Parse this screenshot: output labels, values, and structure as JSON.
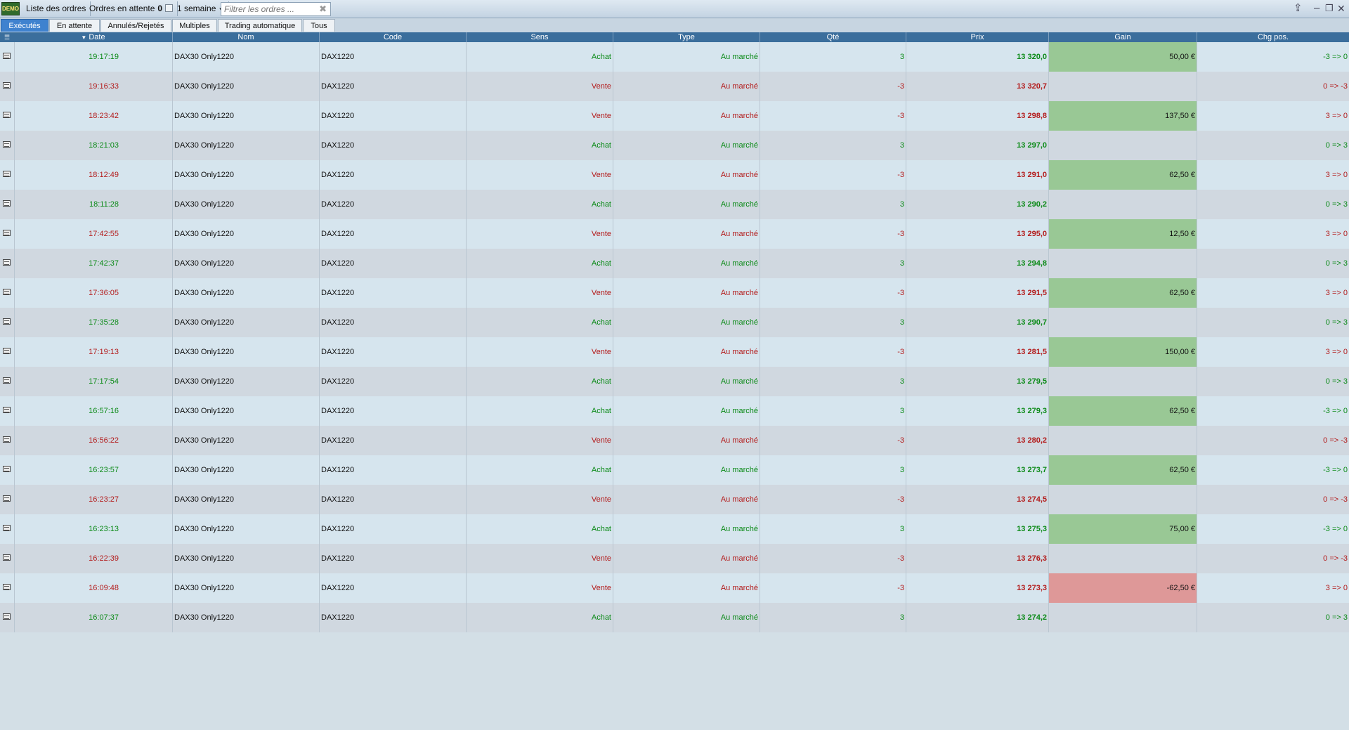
{
  "topbar": {
    "logo_label": "DEMO",
    "title": "Liste des ordres",
    "pending_label": "Ordres en attente",
    "pending_count": "0",
    "period": "1 semaine",
    "filter_placeholder": "Filtrer les ordres ...",
    "filter_clear": "✖",
    "share_icon": "⇪",
    "minimize": "–",
    "restore": "❐",
    "close": "✕"
  },
  "tabs": [
    {
      "label": "Exécutés",
      "active": true
    },
    {
      "label": "En attente"
    },
    {
      "label": "Annulés/Rejetés"
    },
    {
      "label": "Multiples"
    },
    {
      "label": "Trading automatique"
    },
    {
      "label": "Tous"
    }
  ],
  "columns": {
    "date": "Date",
    "nom": "Nom",
    "code": "Code",
    "sens": "Sens",
    "type": "Type",
    "qte": "Qté",
    "prix": "Prix",
    "gain": "Gain",
    "chg": "Chg pos."
  },
  "orders": [
    {
      "date": "19:17:19",
      "nom": "DAX30 Only1220",
      "code": "DAX1220",
      "sens": "Achat",
      "type": "Au marché",
      "qte": "3",
      "prix": "13 320,0",
      "gain": "50,00 €",
      "chg": "-3 => 0"
    },
    {
      "date": "19:16:33",
      "nom": "DAX30 Only1220",
      "code": "DAX1220",
      "sens": "Vente",
      "type": "Au marché",
      "qte": "-3",
      "prix": "13 320,7",
      "gain": "",
      "chg": "0 => -3"
    },
    {
      "date": "18:23:42",
      "nom": "DAX30 Only1220",
      "code": "DAX1220",
      "sens": "Vente",
      "type": "Au marché",
      "qte": "-3",
      "prix": "13 298,8",
      "gain": "137,50 €",
      "chg": "3 => 0"
    },
    {
      "date": "18:21:03",
      "nom": "DAX30 Only1220",
      "code": "DAX1220",
      "sens": "Achat",
      "type": "Au marché",
      "qte": "3",
      "prix": "13 297,0",
      "gain": "",
      "chg": "0 => 3"
    },
    {
      "date": "18:12:49",
      "nom": "DAX30 Only1220",
      "code": "DAX1220",
      "sens": "Vente",
      "type": "Au marché",
      "qte": "-3",
      "prix": "13 291,0",
      "gain": "62,50 €",
      "chg": "3 => 0"
    },
    {
      "date": "18:11:28",
      "nom": "DAX30 Only1220",
      "code": "DAX1220",
      "sens": "Achat",
      "type": "Au marché",
      "qte": "3",
      "prix": "13 290,2",
      "gain": "",
      "chg": "0 => 3"
    },
    {
      "date": "17:42:55",
      "nom": "DAX30 Only1220",
      "code": "DAX1220",
      "sens": "Vente",
      "type": "Au marché",
      "qte": "-3",
      "prix": "13 295,0",
      "gain": "12,50 €",
      "chg": "3 => 0"
    },
    {
      "date": "17:42:37",
      "nom": "DAX30 Only1220",
      "code": "DAX1220",
      "sens": "Achat",
      "type": "Au marché",
      "qte": "3",
      "prix": "13 294,8",
      "gain": "",
      "chg": "0 => 3"
    },
    {
      "date": "17:36:05",
      "nom": "DAX30 Only1220",
      "code": "DAX1220",
      "sens": "Vente",
      "type": "Au marché",
      "qte": "-3",
      "prix": "13 291,5",
      "gain": "62,50 €",
      "chg": "3 => 0"
    },
    {
      "date": "17:35:28",
      "nom": "DAX30 Only1220",
      "code": "DAX1220",
      "sens": "Achat",
      "type": "Au marché",
      "qte": "3",
      "prix": "13 290,7",
      "gain": "",
      "chg": "0 => 3"
    },
    {
      "date": "17:19:13",
      "nom": "DAX30 Only1220",
      "code": "DAX1220",
      "sens": "Vente",
      "type": "Au marché",
      "qte": "-3",
      "prix": "13 281,5",
      "gain": "150,00 €",
      "chg": "3 => 0"
    },
    {
      "date": "17:17:54",
      "nom": "DAX30 Only1220",
      "code": "DAX1220",
      "sens": "Achat",
      "type": "Au marché",
      "qte": "3",
      "prix": "13 279,5",
      "gain": "",
      "chg": "0 => 3"
    },
    {
      "date": "16:57:16",
      "nom": "DAX30 Only1220",
      "code": "DAX1220",
      "sens": "Achat",
      "type": "Au marché",
      "qte": "3",
      "prix": "13 279,3",
      "gain": "62,50 €",
      "chg": "-3 => 0"
    },
    {
      "date": "16:56:22",
      "nom": "DAX30 Only1220",
      "code": "DAX1220",
      "sens": "Vente",
      "type": "Au marché",
      "qte": "-3",
      "prix": "13 280,2",
      "gain": "",
      "chg": "0 => -3"
    },
    {
      "date": "16:23:57",
      "nom": "DAX30 Only1220",
      "code": "DAX1220",
      "sens": "Achat",
      "type": "Au marché",
      "qte": "3",
      "prix": "13 273,7",
      "gain": "62,50 €",
      "chg": "-3 => 0"
    },
    {
      "date": "16:23:27",
      "nom": "DAX30 Only1220",
      "code": "DAX1220",
      "sens": "Vente",
      "type": "Au marché",
      "qte": "-3",
      "prix": "13 274,5",
      "gain": "",
      "chg": "0 => -3"
    },
    {
      "date": "16:23:13",
      "nom": "DAX30 Only1220",
      "code": "DAX1220",
      "sens": "Achat",
      "type": "Au marché",
      "qte": "3",
      "prix": "13 275,3",
      "gain": "75,00 €",
      "chg": "-3 => 0"
    },
    {
      "date": "16:22:39",
      "nom": "DAX30 Only1220",
      "code": "DAX1220",
      "sens": "Vente",
      "type": "Au marché",
      "qte": "-3",
      "prix": "13 276,3",
      "gain": "",
      "chg": "0 => -3"
    },
    {
      "date": "16:09:48",
      "nom": "DAX30 Only1220",
      "code": "DAX1220",
      "sens": "Vente",
      "type": "Au marché",
      "qte": "-3",
      "prix": "13 273,3",
      "gain": "-62,50 €",
      "chg": "3 => 0"
    },
    {
      "date": "16:07:37",
      "nom": "DAX30 Only1220",
      "code": "DAX1220",
      "sens": "Achat",
      "type": "Au marché",
      "qte": "3",
      "prix": "13 274,2",
      "gain": "",
      "chg": "0 => 3"
    }
  ],
  "colors": {
    "buy": "#0b8a17",
    "sell": "#b31b1b",
    "gain_positive_bg": "#99c895",
    "gain_negative_bg": "#de9898",
    "header_bg": "#3b6e9c",
    "active_tab": "#3f82cf"
  }
}
